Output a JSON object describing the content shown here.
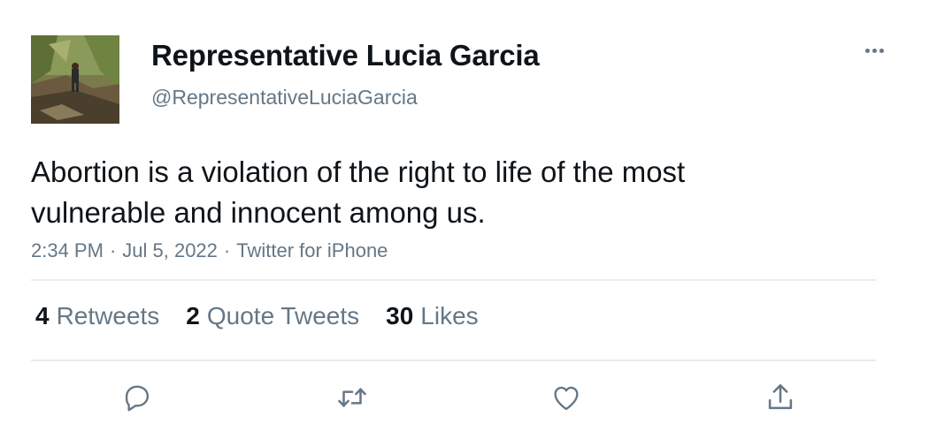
{
  "author": {
    "display_name": "Representative Lucia Garcia",
    "handle": "@RepresentativeLuciaGarcia",
    "avatar_icon": "profile-photo"
  },
  "tweet": {
    "text": "Abortion is a violation of the right to life of the most vulnerable and innocent among us.",
    "time": "2:34 PM",
    "date": "Jul 5, 2022",
    "source": "Twitter for iPhone",
    "separator": "·"
  },
  "stats": {
    "retweets": {
      "count": "4",
      "label": "Retweets"
    },
    "quote_tweets": {
      "count": "2",
      "label": "Quote Tweets"
    },
    "likes": {
      "count": "30",
      "label": "Likes"
    }
  },
  "actions": {
    "reply_icon": "comment-icon",
    "retweet_icon": "retweet-icon",
    "like_icon": "heart-icon",
    "share_icon": "share-icon"
  },
  "colors": {
    "text_primary": "#0f1419",
    "text_secondary": "#657786",
    "divider": "#e6ecf0"
  }
}
